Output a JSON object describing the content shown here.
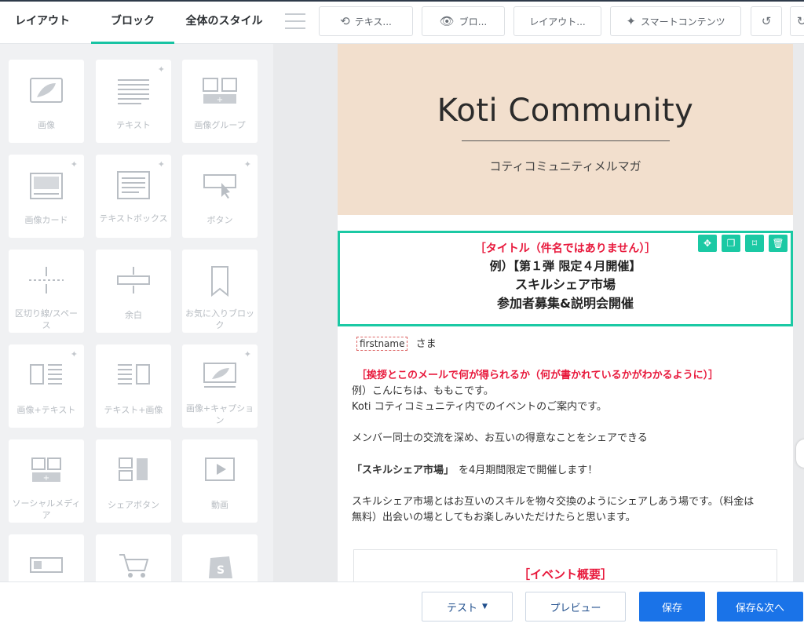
{
  "topbar": {
    "tabs": [
      {
        "label": "レイアウト"
      },
      {
        "label": "ブロック"
      },
      {
        "label": "全体のスタイル"
      }
    ],
    "tools": [
      {
        "label": "テキス...",
        "icon": "text-direction-icon"
      },
      {
        "label": "ブロ...",
        "icon": "eye-slash-icon"
      },
      {
        "label": "レイアウト..."
      },
      {
        "label": "スマートコンテンツ",
        "icon": "smart-content-icon"
      }
    ]
  },
  "blocks": [
    {
      "label": "画像",
      "icon": "image-icon"
    },
    {
      "label": "テキスト",
      "icon": "text-icon",
      "spark": true
    },
    {
      "label": "画像グループ",
      "icon": "image-group-icon"
    },
    {
      "label": "画像カード",
      "icon": "image-card-icon",
      "spark": true
    },
    {
      "label": "テキストボックス",
      "icon": "text-box-icon",
      "spark": true
    },
    {
      "label": "ボタン",
      "icon": "button-icon",
      "spark": true
    },
    {
      "label": "区切り線/スペース",
      "icon": "divider-icon"
    },
    {
      "label": "余白",
      "icon": "spacer-icon"
    },
    {
      "label": "お気に入りブロック",
      "icon": "bookmark-icon"
    },
    {
      "label": "画像+テキスト",
      "icon": "image-text-icon",
      "spark": true
    },
    {
      "label": "テキスト+画像",
      "icon": "text-image-icon"
    },
    {
      "label": "画像+キャプション",
      "icon": "image-caption-icon",
      "spark": true
    },
    {
      "label": "ソーシャルメディア",
      "icon": "social-media-icon"
    },
    {
      "label": "シェアボタン",
      "icon": "share-button-icon"
    },
    {
      "label": "動画",
      "icon": "video-icon"
    },
    {
      "label": "",
      "icon": "product-card-icon"
    },
    {
      "label": "",
      "icon": "cart-icon"
    },
    {
      "label": "",
      "icon": "shopify-icon"
    }
  ],
  "email": {
    "logo": "Koti Community",
    "subtitle": "コティコミュニティメルマガ",
    "title_red": "［タイトル（件名ではありません）］",
    "title_l1": "例）【第１弾 限定４月開催】",
    "title_l2": "スキルシェア市場",
    "title_l3": "参加者募集&説明会開催",
    "firstname_token": "firstname",
    "salutation": "さま",
    "greeting_red": "［挨拶とこのメールで何が得られるか（何が書かれているかがわかるように）］",
    "line1": "例）こんにちは、ももこです。",
    "line2": "Koti コティコミュニティ内でのイベントのご案内です。",
    "line3": "メンバー同士の交流を深め、お互いの得意なことをシェアできる",
    "line4_bold": "「スキルシェア市場」",
    "line4_rest": "を4月期間限定で開催します！",
    "line5": "スキルシェア市場とはお互いのスキルを物々交換のようにシェアしあう場です。（料金は",
    "line6": "無料）出会いの場としてもお楽しみいただけたらと思います。",
    "event_heading": "［イベント概要］"
  },
  "bottombar": {
    "test_label": "テスト",
    "preview_label": "プレビュー",
    "save_label": "保存",
    "save_next_label": "保存&次へ"
  },
  "colors": {
    "accent": "#1bc9a4",
    "primary": "#1a73e8",
    "red": "#e8193c",
    "header_bg": "#f2dfcd"
  }
}
